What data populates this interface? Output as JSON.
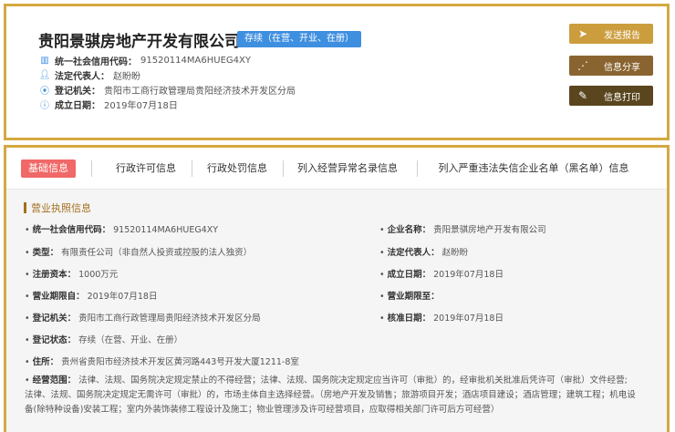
{
  "header": {
    "company_name": "贵阳景骐房地产开发有限公司",
    "status_badge": "存续（在营、开业、在册）",
    "credit_code_label": "统一社会信用代码：",
    "credit_code_value": "91520114MA6HUEG4XY",
    "legal_rep_label": "法定代表人：",
    "legal_rep_value": "赵盼盼",
    "authority_label": "登记机关：",
    "authority_value": "贵阳市工商行政管理局贵阳经济技术开发区分局",
    "founded_label": "成立日期：",
    "founded_value": "2019年07月18日"
  },
  "actions": {
    "report": "发送报告",
    "share": "信息分享",
    "print": "信息打印"
  },
  "tabs": [
    {
      "label": "基础信息"
    },
    {
      "label": "行政许可信息"
    },
    {
      "label": "行政处罚信息"
    },
    {
      "label": "列入经营异常名录信息"
    },
    {
      "label": "列入严重违法失信企业名单（黑名单）信息"
    }
  ],
  "section_title": "营业执照信息",
  "fields": {
    "credit_code": {
      "label": "统一社会信用代码：",
      "value": "91520114MA6HUEG4XY"
    },
    "company_name": {
      "label": "企业名称：",
      "value": "贵阳景骐房地产开发有限公司"
    },
    "type": {
      "label": "类型：",
      "value": "有限责任公司（非自然人投资或控股的法人独资）"
    },
    "legal_rep": {
      "label": "法定代表人：",
      "value": "赵盼盼"
    },
    "capital": {
      "label": "注册资本：",
      "value": "1000万元"
    },
    "founded": {
      "label": "成立日期：",
      "value": "2019年07月18日"
    },
    "term_from": {
      "label": "营业期限自：",
      "value": "2019年07月18日"
    },
    "term_to": {
      "label": "营业期限至：",
      "value": ""
    },
    "authority": {
      "label": "登记机关：",
      "value": "贵阳市工商行政管理局贵阳经济技术开发区分局"
    },
    "approved": {
      "label": "核准日期：",
      "value": "2019年07月18日"
    },
    "reg_status": {
      "label": "登记状态：",
      "value": "存续（在营、开业、在册）"
    },
    "address": {
      "label": "住所：",
      "value": "贵州省贵阳市经济技术开发区黄河路443号开发大厦1211-8室"
    },
    "scope": {
      "label": "经营范围：",
      "value": "法律、法规、国务院决定规定禁止的不得经营；法律、法规、国务院决定规定应当许可（审批）的，经审批机关批准后凭许可（审批）文件经营;法律、法规、国务院决定规定无需许可（审批）的，市场主体自主选择经营。（房地产开发及销售；旅游项目开发；酒店项目建设；酒店管理；建筑工程；机电设备(除特种设备)安装工程；室内外装饰装修工程设计及施工；物业管理涉及许可经营项目，应取得相关部门许可后方可经营）"
    }
  }
}
